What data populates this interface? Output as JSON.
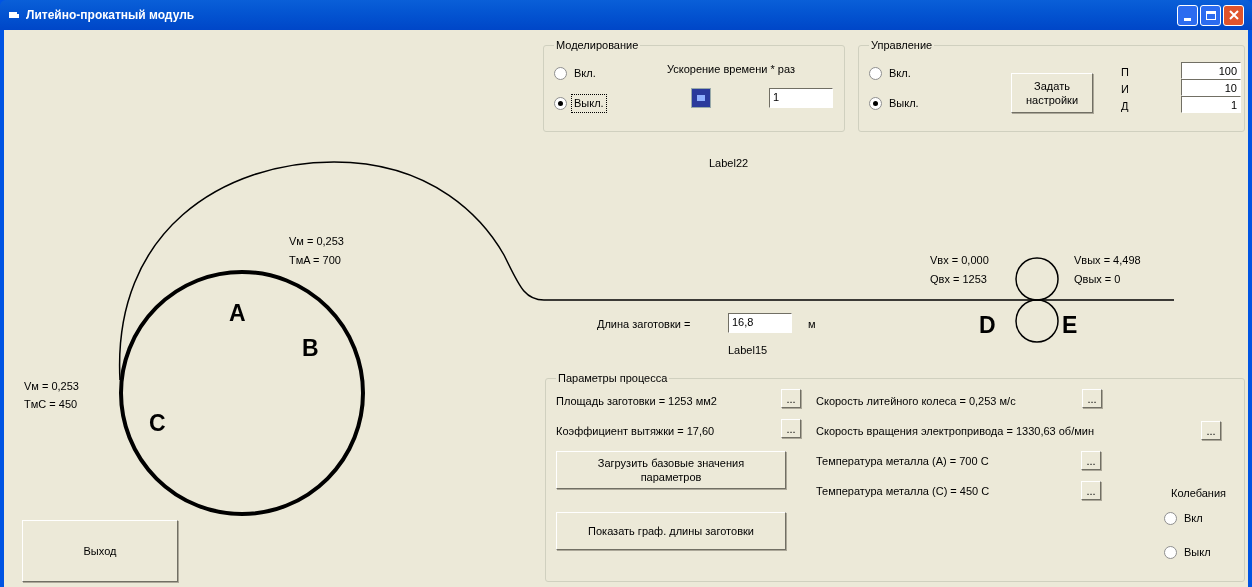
{
  "window": {
    "title": "Литейно-прокатный модуль"
  },
  "simulation": {
    "title": "Моделирование",
    "options": [
      {
        "label": "Вкл.",
        "selected": false,
        "focused": false
      },
      {
        "label": "Выкл.",
        "selected": true,
        "focused": true
      }
    ],
    "speed_label": "Ускорение времени * раз",
    "speed_value": "1"
  },
  "control": {
    "title": "Управление",
    "options": [
      {
        "label": "Вкл.",
        "selected": false,
        "focused": false
      },
      {
        "label": "Выкл.",
        "selected": true,
        "focused": false
      }
    ],
    "button": "Задать настройки",
    "pid": [
      {
        "label": "П",
        "value": "100"
      },
      {
        "label": "И",
        "value": "10"
      },
      {
        "label": "Д",
        "value": "1"
      }
    ]
  },
  "top_label": "Label22",
  "diagram": {
    "wheel_top": [
      "Vм = 0,253",
      "TмA = 700"
    ],
    "wheel_left": [
      "Vм = 0,253",
      "TмC = 450"
    ],
    "letters": [
      "A",
      "B",
      "C",
      "D",
      "E"
    ],
    "inlet": [
      "Vвх = 0,000",
      "Qвх = 1253"
    ],
    "outlet": [
      "Vвых = 4,498",
      "Qвых = 0"
    ]
  },
  "length": {
    "label": "Длина заготовки =",
    "value": "16,8",
    "unit": "м",
    "note": "Label15"
  },
  "params": {
    "title": "Параметры процесса",
    "rows": [
      {
        "text": "Площадь заготовки = 1253 мм2",
        "button": "..."
      },
      {
        "text": "Коэффициент вытяжки = 17,60",
        "button": "..."
      },
      {
        "text": "Скорость литейного колеса = 0,253 м/с",
        "button": "..."
      },
      {
        "text": "Скорость вращения электропривода = 1330,63 об/мин",
        "button": "..."
      },
      {
        "text": "Температура металла (А) = 700 С",
        "button": "..."
      },
      {
        "text": "Температура металла (С) = 450 С",
        "button": "..."
      }
    ],
    "load_button": "Загрузить базовые значения параметров",
    "graph_button": "Показать граф. длины заготовки"
  },
  "oscillation": {
    "title": "Колебания",
    "options": [
      {
        "label": "Вкл",
        "selected": false,
        "focused": false
      },
      {
        "label": "Выкл",
        "selected": false,
        "focused": false
      }
    ]
  },
  "exit_button": "Выход"
}
